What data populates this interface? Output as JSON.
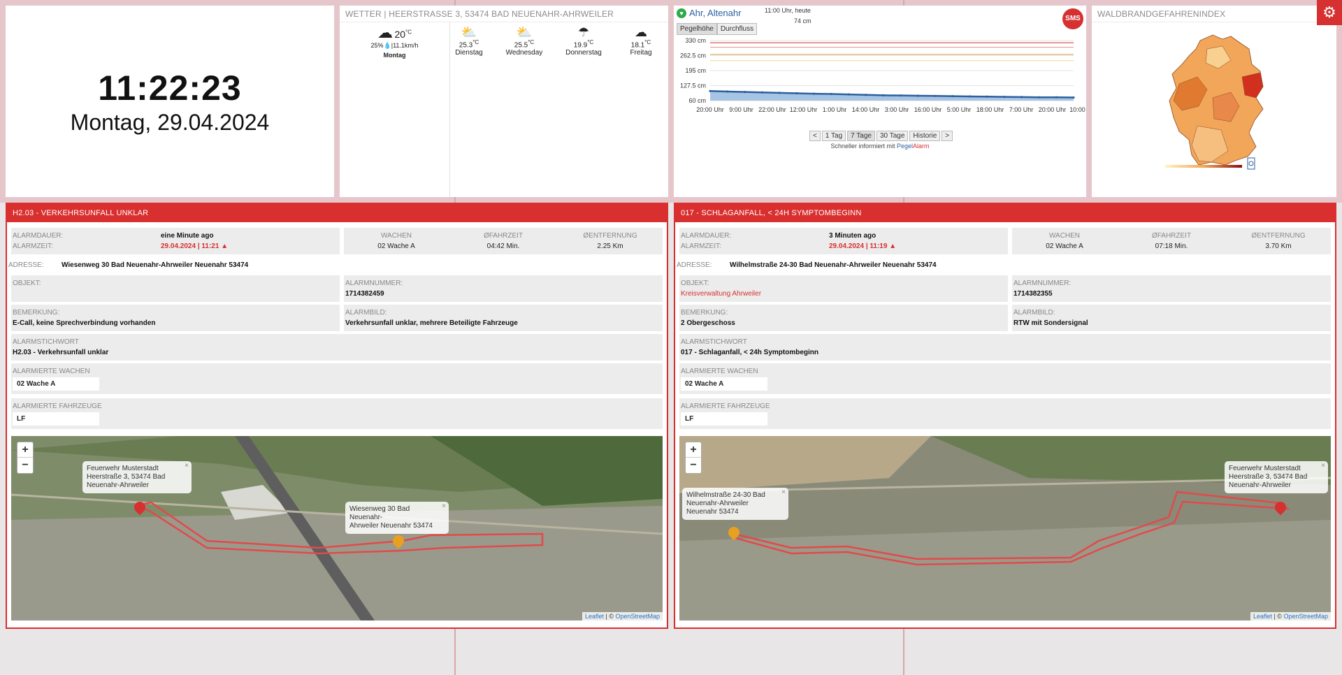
{
  "clock": {
    "time": "11:22:23",
    "date": "Montag, 29.04.2024"
  },
  "weather": {
    "title": "WETTER | HEERSTRASSE 3, 53474 BAD NEUENAHR-AHRWEILER",
    "today": {
      "temp": "20",
      "unit": "°C",
      "details": "25%💧|11.1km/h",
      "day": "Montag",
      "icon": "cloud-icon"
    },
    "forecast": [
      {
        "day": "Dienstag",
        "temp": "25.3",
        "unit": "°C",
        "icon": "partly-sunny-icon"
      },
      {
        "day": "Wednesday",
        "temp": "25.5",
        "unit": "°C",
        "icon": "partly-sunny-icon"
      },
      {
        "day": "Donnerstag",
        "temp": "19.9",
        "unit": "°C",
        "icon": "rain-icon"
      },
      {
        "day": "Freitag",
        "temp": "18.1",
        "unit": "°C",
        "icon": "showers-icon"
      }
    ]
  },
  "pegel": {
    "station": "Ahr, Altenahr",
    "time": "11:00 Uhr, heute",
    "level": "74 cm",
    "sms": "SMS",
    "tabs": [
      "Pegelhöhe",
      "Durchfluss"
    ],
    "nav": [
      "<",
      "1 Tag",
      "7 Tage",
      "30 Tage",
      "Historie",
      ">"
    ],
    "promo_prefix": "Schneller informiert mit ",
    "promo_brand_a": "Pegel",
    "promo_brand_b": "Alarm"
  },
  "chart_data": {
    "type": "area",
    "y_ticks": [
      "330 cm",
      "262.5 cm",
      "195 cm",
      "127.5 cm",
      "60 cm"
    ],
    "ylim": [
      60,
      330
    ],
    "x_ticks": [
      "20:00 Uhr",
      "9:00 Uhr",
      "22:00 Uhr",
      "12:00 Uhr",
      "1:00 Uhr",
      "14:00 Uhr",
      "3:00 Uhr",
      "16:00 Uhr",
      "5:00 Uhr",
      "18:00 Uhr",
      "7:00 Uhr",
      "20:00 Uhr",
      "10:00 Uhr"
    ],
    "series": [
      {
        "values": [
          103,
          101,
          99,
          97,
          95,
          93,
          91,
          90,
          88,
          86,
          84,
          83,
          82,
          81,
          80,
          79,
          78,
          77,
          76,
          75,
          75,
          74
        ]
      }
    ],
    "reference_lines": [
      320,
      300,
      268,
      240
    ],
    "reference_colors": [
      "#d64545",
      "#e39a9a",
      "#e0b060",
      "#e8e0a0"
    ],
    "fill_color": "#a8c4e4",
    "line_color": "#2c5f9e"
  },
  "wald": {
    "title": "WALDBRANDGEFAHRENINDEX"
  },
  "alarms": [
    {
      "title": "H2.03 - VERKEHRSUNFALL UNKLAR",
      "dauer_label": "ALARMDAUER:",
      "dauer": "eine Minute ago",
      "zeit_label": "ALARMZEIT:",
      "zeit": "29.04.2024 | 11:21",
      "wachen_label": "WACHEN",
      "wachen": "02 Wache A",
      "fahrzeit_label": "ØFAHRZEIT",
      "fahrzeit": "04:42 Min.",
      "entf_label": "ØENTFERNUNG",
      "entf": "2.25 Km",
      "adresse_label": "ADRESSE:",
      "adresse": "Wiesenweg 30 Bad Neuenahr-Ahrweiler Neuenahr 53474",
      "objekt_label": "OBJEKT:",
      "objekt": "",
      "nummer_label": "ALARMNUMMER:",
      "nummer": "1714382459",
      "bemerkung_label": "BEMERKUNG:",
      "bemerkung": "E-Call, keine Sprechverbindung vorhanden",
      "bild_label": "ALARMBILD:",
      "bild": "Verkehrsunfall unklar, mehrere Beteiligte Fahrzeuge",
      "stichwort_label": "ALARMSTICHWORT",
      "stichwort": "H2.03 - Verkehrsunfall unklar",
      "al_wachen_label": "ALARMIERTE WACHEN",
      "al_wachen": "02 Wache A",
      "fahrzeuge_label": "ALARMIERTE FAHRZEUGE",
      "fahrzeuge": "LF",
      "popup_station": [
        "Feuerwehr Musterstadt",
        "Heerstraße 3, 53474 Bad",
        "Neuenahr-Ahrweiler"
      ],
      "popup_target": [
        "Wiesenweg 30 Bad Neuenahr-",
        "Ahrweiler Neuenahr 53474"
      ],
      "attr_leaflet": "Leaflet",
      "attr_sep": " | © ",
      "attr_osm": "OpenStreetMap"
    },
    {
      "title": "017 - SCHLAGANFALL, < 24H SYMPTOMBEGINN",
      "dauer_label": "ALARMDAUER:",
      "dauer": "3 Minuten ago",
      "zeit_label": "ALARMZEIT:",
      "zeit": "29.04.2024 | 11:19",
      "wachen_label": "WACHEN",
      "wachen": "02 Wache A",
      "fahrzeit_label": "ØFAHRZEIT",
      "fahrzeit": "07:18 Min.",
      "entf_label": "ØENTFERNUNG",
      "entf": "3.70 Km",
      "adresse_label": "ADRESSE:",
      "adresse": "Wilhelmstraße 24-30 Bad Neuenahr-Ahrweiler Neuenahr 53474",
      "objekt_label": "OBJEKT:",
      "objekt": "Kreisverwaltung Ahrweiler",
      "nummer_label": "ALARMNUMMER:",
      "nummer": "1714382355",
      "bemerkung_label": "BEMERKUNG:",
      "bemerkung": "2 Obergeschoss",
      "bild_label": "ALARMBILD:",
      "bild": "RTW mit Sondersignal",
      "stichwort_label": "ALARMSTICHWORT",
      "stichwort": "017 - Schlaganfall, < 24h Symptombeginn",
      "al_wachen_label": "ALARMIERTE WACHEN",
      "al_wachen": "02 Wache A",
      "fahrzeuge_label": "ALARMIERTE FAHRZEUGE",
      "fahrzeuge": "LF",
      "popup_station": [
        "Feuerwehr Musterstadt",
        "Heerstraße 3, 53474 Bad",
        "Neuenahr-Ahrweiler"
      ],
      "popup_target": [
        "Wilhelmstraße 24-30 Bad",
        "Neuenahr-Ahrweiler",
        "Neuenahr 53474"
      ],
      "attr_leaflet": "Leaflet",
      "attr_sep": " | © ",
      "attr_osm": "OpenStreetMap"
    }
  ],
  "map_zoom": {
    "in": "+",
    "out": "−"
  },
  "settings_icon": "gear-icon"
}
